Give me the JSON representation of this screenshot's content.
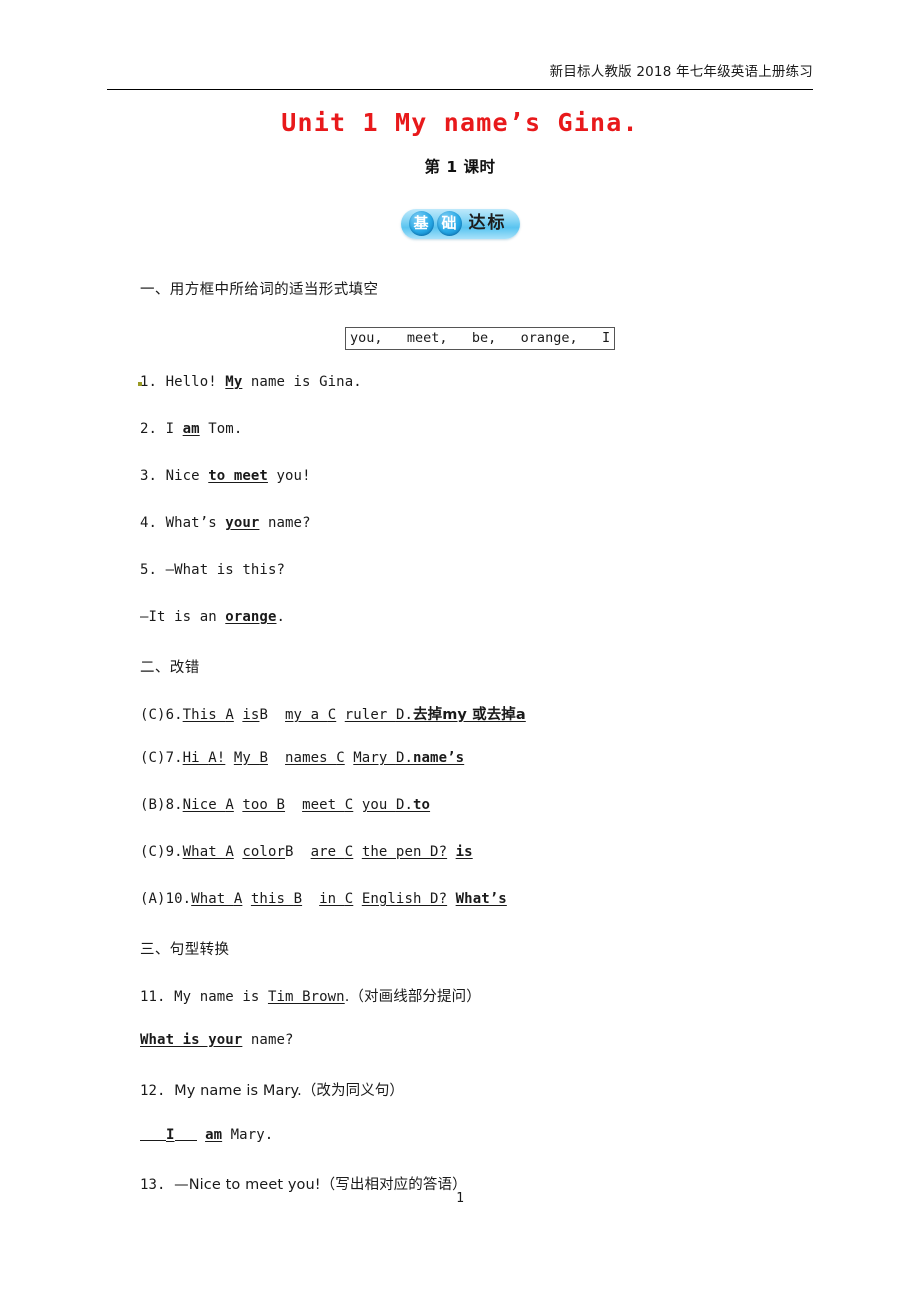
{
  "header": {
    "running_text": "新目标人教版 2018 年七年级英语上册练习"
  },
  "title": {
    "unit": "Unit 1 My name’s Gina.",
    "lesson": "第 1 课时"
  },
  "badge": {
    "char1": "基",
    "char2": "础",
    "rest": "达标",
    "colors": {
      "background_light": "#bfe9fb",
      "background_mid": "#59c4f0",
      "circle_dark": "#0b7cc0",
      "text": "#ffffff"
    }
  },
  "sections": {
    "one": {
      "heading": "一、用方框中所给词的适当形式填空",
      "wordbank": "you,   meet,   be,   orange,   I",
      "items": [
        {
          "number": "1.",
          "pre": "Hello! ",
          "answer": "My",
          "post": " name is Gina."
        },
        {
          "number": "2.",
          "pre": "I ",
          "answer": "am",
          "post": " Tom."
        },
        {
          "number": "3.",
          "pre": "Nice ",
          "answer": "to meet",
          "post": " you!"
        },
        {
          "number": "4.",
          "pre": "What’s ",
          "answer": "your",
          "post": " name?"
        },
        {
          "number": "5.",
          "pre": "—What is this?",
          "answer": "",
          "post": ""
        }
      ],
      "item5_answer_line": {
        "pre": "—It is an  ",
        "answer": "orange",
        "post": "."
      }
    },
    "two": {
      "heading": "二、改错",
      "items": [
        {
          "choice": "(C)",
          "number": "6.",
          "seg1": "This ",
          "lbl1": "A",
          "seg2": "is",
          "lbl2": "B",
          "seg3": "my a ",
          "lbl3": "C",
          "seg4": "ruler ",
          "lbl4": "D.",
          "answer": "去掉my 或去掉a"
        },
        {
          "choice": "(C)",
          "number": "7.",
          "seg1": "Hi ",
          "lbl1": "A!",
          "seg2": "My ",
          "lbl2": "B",
          "seg3": "names ",
          "lbl3": "C",
          "seg4": "Mary ",
          "lbl4": "D.",
          "answer": "name’s"
        },
        {
          "choice": "(B)",
          "number": "8.",
          "seg1": "Nice ",
          "lbl1": "A",
          "seg2": "too ",
          "lbl2": "B",
          "seg3": "meet ",
          "lbl3": "C",
          "seg4": "you ",
          "lbl4": "D.",
          "answer": "to"
        },
        {
          "choice": "(C)",
          "number": "9.",
          "seg1": "What ",
          "lbl1": "A",
          "seg2": "color",
          "lbl2": "B",
          "seg3": "are ",
          "lbl3": "C",
          "seg4": "the pen ",
          "lbl4": "D?",
          "answer": "is"
        },
        {
          "choice": "(A)",
          "number": "10.",
          "seg1": "What ",
          "lbl1": "A",
          "seg2": "this ",
          "lbl2": "B",
          "seg3": "in ",
          "lbl3": "C",
          "seg4": "English ",
          "lbl4": "D?",
          "answer": "What’s"
        }
      ]
    },
    "three": {
      "heading": "三、句型转换",
      "item11": {
        "number": "11.",
        "pre": "My name is ",
        "underlined": "Tim Brown",
        "post": ".（对画线部分提问）"
      },
      "item11_answer": {
        "answer": "What is your",
        "post": " name?"
      },
      "item12": {
        "number": "12.",
        "text": "My name is Mary.（改为同义句）"
      },
      "item12_answer": {
        "blank_answer": "I",
        "answer2": "am",
        "post": " Mary."
      },
      "item13": {
        "number": "13.",
        "text": "—Nice to meet you!（写出相对应的答语）"
      }
    }
  },
  "footer": {
    "page_number": "1"
  }
}
